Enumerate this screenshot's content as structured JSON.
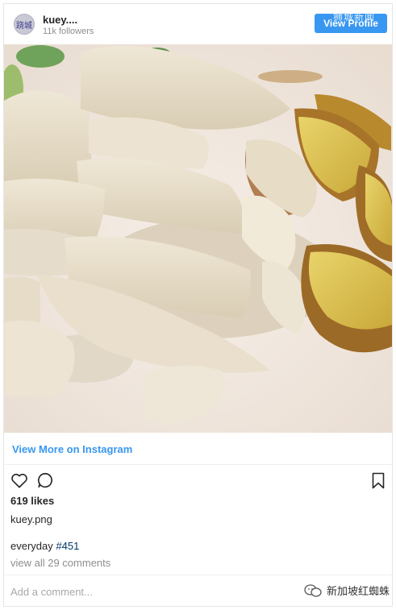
{
  "header": {
    "avatar_text": "跷城",
    "username": "kuey....",
    "followers": "11k followers",
    "view_profile_label": "View Profile",
    "watermark_top": "狮城新闻"
  },
  "post": {
    "view_more_label": "View More on Instagram",
    "likes": "619 likes",
    "caption_user": "kuey.png",
    "caption_text": "everyday ",
    "caption_hashtag": "#451",
    "comments_link": "view all 29 comments",
    "add_comment_placeholder": "Add a comment...",
    "watermark_bottom": "新加坡红蜘蛛"
  },
  "icons": {
    "like": "heart-icon",
    "comment": "comment-icon",
    "save": "bookmark-icon"
  },
  "colors": {
    "accent": "#3897f0",
    "hashtag": "#003569",
    "muted": "#8e8e8e"
  }
}
